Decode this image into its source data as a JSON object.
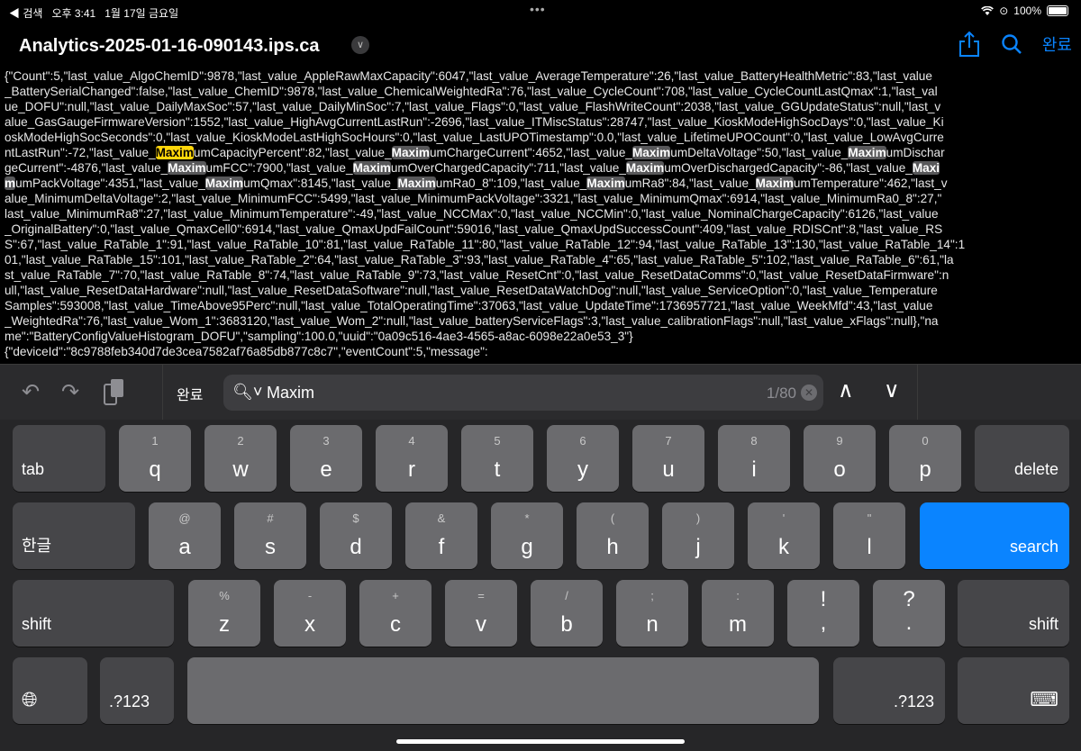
{
  "status_bar": {
    "back_label": "◀ 검색",
    "time": "오후 3:41",
    "date": "1월 17일 금요일",
    "battery": "100%",
    "icons": [
      "wifi-icon",
      "orientation-lock-icon",
      "battery-icon"
    ]
  },
  "header": {
    "title": "Analytics-2025-01-16-090143.ips.ca",
    "done_label": "완료",
    "accent": "#0a84ff"
  },
  "content": {
    "lines": [
      [
        {
          "t": "{\"Count\":5,\"last_value_AlgoChemID\":9878,\"last_value_AppleRawMaxCapacity\":6047,\"last_value_AverageTemperature\":26,\"last_value_BatteryHealthMetric\":83,\"last_value"
        }
      ],
      [
        {
          "t": "_BatterySerialChanged\":false,\"last_value_ChemID\":9878,\"last_value_ChemicalWeightedRa\":76,\"last_value_CycleCount\":708,\"last_value_CycleCountLastQmax\":1,\"last_val"
        }
      ],
      [
        {
          "t": "ue_DOFU\":null,\"last_value_DailyMaxSoc\":57,\"last_value_DailyMinSoc\":7,\"last_value_Flags\":0,\"last_value_FlashWriteCount\":2038,\"last_value_GGUpdateStatus\":null,\"last_v"
        }
      ],
      [
        {
          "t": "alue_GasGaugeFirmwareVersion\":1552,\"last_value_HighAvgCurrentLastRun\":-2696,\"last_value_ITMiscStatus\":28747,\"last_value_KioskModeHighSocDays\":0,\"last_value_Ki"
        }
      ],
      [
        {
          "t": "oskModeHighSocSeconds\":0,\"last_value_KioskModeLastHighSocHours\":0,\"last_value_LastUPOTimestamp\":0.0,\"last_value_LifetimeUPOCount\":0,\"last_value_LowAvgCurre"
        }
      ],
      [
        {
          "t": "ntLastRun\":-72,\"last_value_"
        },
        {
          "t": "Maxim",
          "hl": "cur"
        },
        {
          "t": "umCapacityPercent\":82,\"last_value_"
        },
        {
          "t": "Maxim",
          "hl": "y"
        },
        {
          "t": "umChargeCurrent\":4652,\"last_value_"
        },
        {
          "t": "Maxim",
          "hl": "y"
        },
        {
          "t": "umDeltaVoltage\":50,\"last_value_"
        },
        {
          "t": "Maxim",
          "hl": "y"
        },
        {
          "t": "umDischar"
        }
      ],
      [
        {
          "t": "geCurrent\":-4876,\"last_value_"
        },
        {
          "t": "Maxim",
          "hl": "y"
        },
        {
          "t": "umFCC\":7900,\"last_value_"
        },
        {
          "t": "Maxim",
          "hl": "y"
        },
        {
          "t": "umOverChargedCapacity\":711,\"last_value_"
        },
        {
          "t": "Maxim",
          "hl": "y"
        },
        {
          "t": "umOverDischargedCapacity\":-86,\"last_value_"
        },
        {
          "t": "Maxi",
          "hl": "y"
        }
      ],
      [
        {
          "t": "m",
          "hl": "y"
        },
        {
          "t": "umPackVoltage\":4351,\"last_value_"
        },
        {
          "t": "Maxim",
          "hl": "y"
        },
        {
          "t": "umQmax\":8145,\"last_value_"
        },
        {
          "t": "Maxim",
          "hl": "y"
        },
        {
          "t": "umRa0_8\":109,\"last_value_"
        },
        {
          "t": "Maxim",
          "hl": "y"
        },
        {
          "t": "umRa8\":84,\"last_value_"
        },
        {
          "t": "Maxim",
          "hl": "y"
        },
        {
          "t": "umTemperature\":462,\"last_v"
        }
      ],
      [
        {
          "t": "alue_MinimumDeltaVoltage\":2,\"last_value_MinimumFCC\":5499,\"last_value_MinimumPackVoltage\":3321,\"last_value_MinimumQmax\":6914,\"last_value_MinimumRa0_8\":27,\""
        }
      ],
      [
        {
          "t": "last_value_MinimumRa8\":27,\"last_value_MinimumTemperature\":-49,\"last_value_NCCMax\":0,\"last_value_NCCMin\":0,\"last_value_NominalChargeCapacity\":6126,\"last_value"
        }
      ],
      [
        {
          "t": "_OriginalBattery\":0,\"last_value_QmaxCell0\":6914,\"last_value_QmaxUpdFailCount\":59016,\"last_value_QmaxUpdSuccessCount\":409,\"last_value_RDISCnt\":8,\"last_value_RS"
        }
      ],
      [
        {
          "t": "S\":67,\"last_value_RaTable_1\":91,\"last_value_RaTable_10\":81,\"last_value_RaTable_11\":80,\"last_value_RaTable_12\":94,\"last_value_RaTable_13\":130,\"last_value_RaTable_14\":1"
        }
      ],
      [
        {
          "t": "01,\"last_value_RaTable_15\":101,\"last_value_RaTable_2\":64,\"last_value_RaTable_3\":93,\"last_value_RaTable_4\":65,\"last_value_RaTable_5\":102,\"last_value_RaTable_6\":61,\"la"
        }
      ],
      [
        {
          "t": "st_value_RaTable_7\":70,\"last_value_RaTable_8\":74,\"last_value_RaTable_9\":73,\"last_value_ResetCnt\":0,\"last_value_ResetDataComms\":0,\"last_value_ResetDataFirmware\":n"
        }
      ],
      [
        {
          "t": "ull,\"last_value_ResetDataHardware\":null,\"last_value_ResetDataSoftware\":null,\"last_value_ResetDataWatchDog\":null,\"last_value_ServiceOption\":0,\"last_value_Temperature"
        }
      ],
      [
        {
          "t": "Samples\":593008,\"last_value_TimeAbove95Perc\":null,\"last_value_TotalOperatingTime\":37063,\"last_value_UpdateTime\":1736957721,\"last_value_WeekMfd\":43,\"last_value"
        }
      ],
      [
        {
          "t": "_WeightedRa\":76,\"last_value_Wom_1\":3683120,\"last_value_Wom_2\":null,\"last_value_batteryServiceFlags\":3,\"last_value_calibrationFlags\":null,\"last_value_xFlags\":null},\"na"
        }
      ],
      [
        {
          "t": "me\":\"BatteryConfigValueHistogram_DOFU\",\"sampling\":100.0,\"uuid\":\"0a09c516-4ae3-4565-a8ac-6098e22a0e53_3\"}"
        }
      ],
      [
        {
          "t": "{\"deviceId\":\"8c9788feb340d7de3cea7582af76a85db877c8c7\",\"eventCount\":5,\"message\":"
        }
      ]
    ]
  },
  "find_bar": {
    "done_label": "완료",
    "query": "Maxim",
    "match_count": "1/80"
  },
  "keyboard": {
    "row1": [
      {
        "n": "1",
        "c": "q"
      },
      {
        "n": "2",
        "c": "w"
      },
      {
        "n": "3",
        "c": "e"
      },
      {
        "n": "4",
        "c": "r"
      },
      {
        "n": "5",
        "c": "t"
      },
      {
        "n": "6",
        "c": "y"
      },
      {
        "n": "7",
        "c": "u"
      },
      {
        "n": "8",
        "c": "i"
      },
      {
        "n": "9",
        "c": "o"
      },
      {
        "n": "0",
        "c": "p"
      }
    ],
    "row2": [
      {
        "n": "@",
        "c": "a"
      },
      {
        "n": "#",
        "c": "s"
      },
      {
        "n": "$",
        "c": "d"
      },
      {
        "n": "&",
        "c": "f"
      },
      {
        "n": "*",
        "c": "g"
      },
      {
        "n": "(",
        "c": "h"
      },
      {
        "n": ")",
        "c": "j"
      },
      {
        "n": "'",
        "c": "k"
      },
      {
        "n": "\"",
        "c": "l"
      }
    ],
    "row3": [
      {
        "n": "%",
        "c": "z"
      },
      {
        "n": "-",
        "c": "x"
      },
      {
        "n": "+",
        "c": "c"
      },
      {
        "n": "=",
        "c": "v"
      },
      {
        "n": "/",
        "c": "b"
      },
      {
        "n": ";",
        "c": "n"
      },
      {
        "n": ":",
        "c": "m"
      },
      {
        "n": "!",
        "c": ","
      },
      {
        "n": "?",
        "c": "."
      }
    ],
    "tab": "tab",
    "delete": "delete",
    "lang": "한글",
    "search": "search",
    "shift": "shift",
    "numbers": ".?123"
  }
}
